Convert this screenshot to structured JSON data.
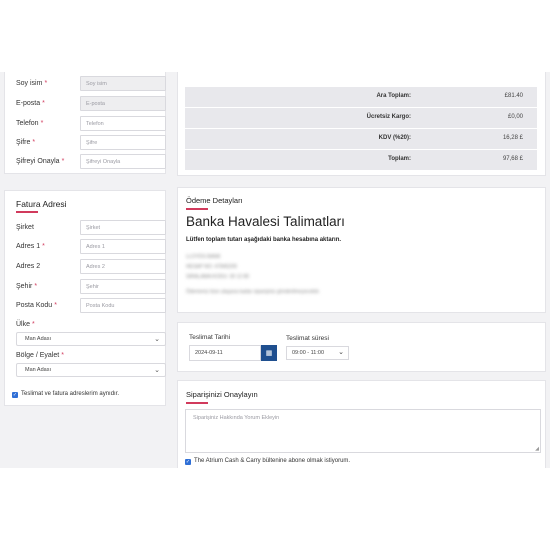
{
  "shipping_form": {
    "fields": [
      {
        "label": "Soy isim",
        "required": "*",
        "placeholder": "Soy isim"
      },
      {
        "label": "E-posta",
        "required": "*",
        "placeholder": "E-posta"
      },
      {
        "label": "Telefon",
        "required": "*",
        "placeholder": "Telefon"
      },
      {
        "label": "Şifre",
        "required": "*",
        "placeholder": "Şifre"
      },
      {
        "label": "Şifreyi Onayla",
        "required": "*",
        "placeholder": "Şifreyi Onayla"
      }
    ]
  },
  "billing": {
    "title": "Fatura Adresi",
    "fields": [
      {
        "label": "Şirket",
        "required": "",
        "placeholder": "Şirket"
      },
      {
        "label": "Adres 1",
        "required": "*",
        "placeholder": "Adres 1"
      },
      {
        "label": "Adres 2",
        "required": "",
        "placeholder": "Adres 2"
      },
      {
        "label": "Şehir",
        "required": "*",
        "placeholder": "Şehir"
      },
      {
        "label": "Posta Kodu",
        "required": "*",
        "placeholder": "Posta Kodu"
      }
    ],
    "country_label": "Ülke",
    "country_required": "*",
    "country_value": "Man Adası",
    "region_label": "Bölge / Eyalet",
    "region_required": "*",
    "region_value": "Man Adası",
    "same_address_label": "Teslimat ve fatura adreslerim aynıdır."
  },
  "summary": {
    "rows": [
      {
        "key": "Ara Toplam:",
        "value": "£81.40"
      },
      {
        "key": "Ücretsiz Kargo:",
        "value": "£0,00"
      },
      {
        "key": "KDV (%20):",
        "value": "16,28 £"
      },
      {
        "key": "Toplam:",
        "value": "97,68 £"
      }
    ]
  },
  "payment": {
    "section_title": "Ödeme Detayları",
    "heading": "Banka Havalesi Talimatları",
    "instruction": "Lütfen toplam tutarı aşağıdaki banka hesabına aktarın.",
    "bank_lines": [
      "LLOYDS BANK",
      "HESAP NO: 47845209",
      "SIRALAMA KODU: 30 12 80"
    ],
    "note": "Ödemeniz bize ulaşana kadar siparişiniz gönderilmeyecektir."
  },
  "delivery": {
    "date_label": "Teslimat Tarihi",
    "date_value": "2024-09-11",
    "time_label": "Teslimat süresi",
    "time_value": "09:00 - 11:00"
  },
  "confirm": {
    "title": "Siparişinizi Onaylayın",
    "comment_placeholder": "Siparişiniz Hakkında Yorum Ekleyin",
    "newsletter_label": "The Atrium Cash & Carry bültenine abone olmak istiyorum."
  },
  "colors": {
    "accent": "#d13a5c",
    "primary": "#1f4f8f",
    "checkbox": "#2f6fd6"
  },
  "icons": {
    "calendar": "calendar-icon",
    "chevron": "chevron-down-icon",
    "check": "check-icon"
  }
}
